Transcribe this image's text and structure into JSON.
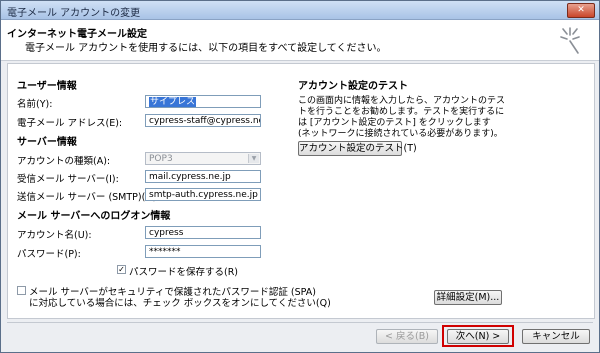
{
  "window": {
    "title": "電子メール アカウントの変更",
    "close_glyph": "✕"
  },
  "header": {
    "title": "インターネット電子メール設定",
    "subtitle": "電子メール アカウントを使用するには、以下の項目をすべて設定してください。"
  },
  "user_info": {
    "section": "ユーザー情報",
    "name_label": "名前(Y):",
    "name_value": "サイプレス",
    "email_label": "電子メール アドレス(E):",
    "email_value": "cypress-staff@cypress.ne.jp"
  },
  "server_info": {
    "section": "サーバー情報",
    "account_type_label": "アカウントの種類(A):",
    "account_type_value": "POP3",
    "incoming_label": "受信メール サーバー(I):",
    "incoming_value": "mail.cypress.ne.jp",
    "outgoing_label": "送信メール サーバー (SMTP)(O):",
    "outgoing_value": "smtp-auth.cypress.ne.jp"
  },
  "logon_info": {
    "section": "メール サーバーへのログオン情報",
    "account_label": "アカウント名(U):",
    "account_value": "cypress",
    "password_label": "パスワード(P):",
    "password_value": "*******",
    "remember_label": "パスワードを保存する(R)",
    "remember_checked": true,
    "spa_label_1": "メール サーバーがセキュリティで保護されたパスワード認証 (SPA)",
    "spa_label_2": "に対応している場合には、チェック ボックスをオンにしてください(Q)",
    "spa_checked": false
  },
  "test": {
    "section": "アカウント設定のテスト",
    "description": "この画面内に情報を入力したら、アカウントのテストを行うことをお勧めします。テストを実行するには [アカウント設定のテスト] をクリックします (ネットワークに接続されている必要があります)。",
    "test_button": "アカウント設定のテスト(T)"
  },
  "buttons": {
    "more_settings": "詳細設定(M)...",
    "back": "< 戻る(B)",
    "next": "次へ(N) >",
    "cancel": "キャンセル"
  },
  "colors": {
    "highlight": "#d00000",
    "selection": "#3875d7"
  },
  "icons": {
    "sparkle": "sparkle-icon",
    "check": "✓",
    "combo_arrow": "▼"
  }
}
